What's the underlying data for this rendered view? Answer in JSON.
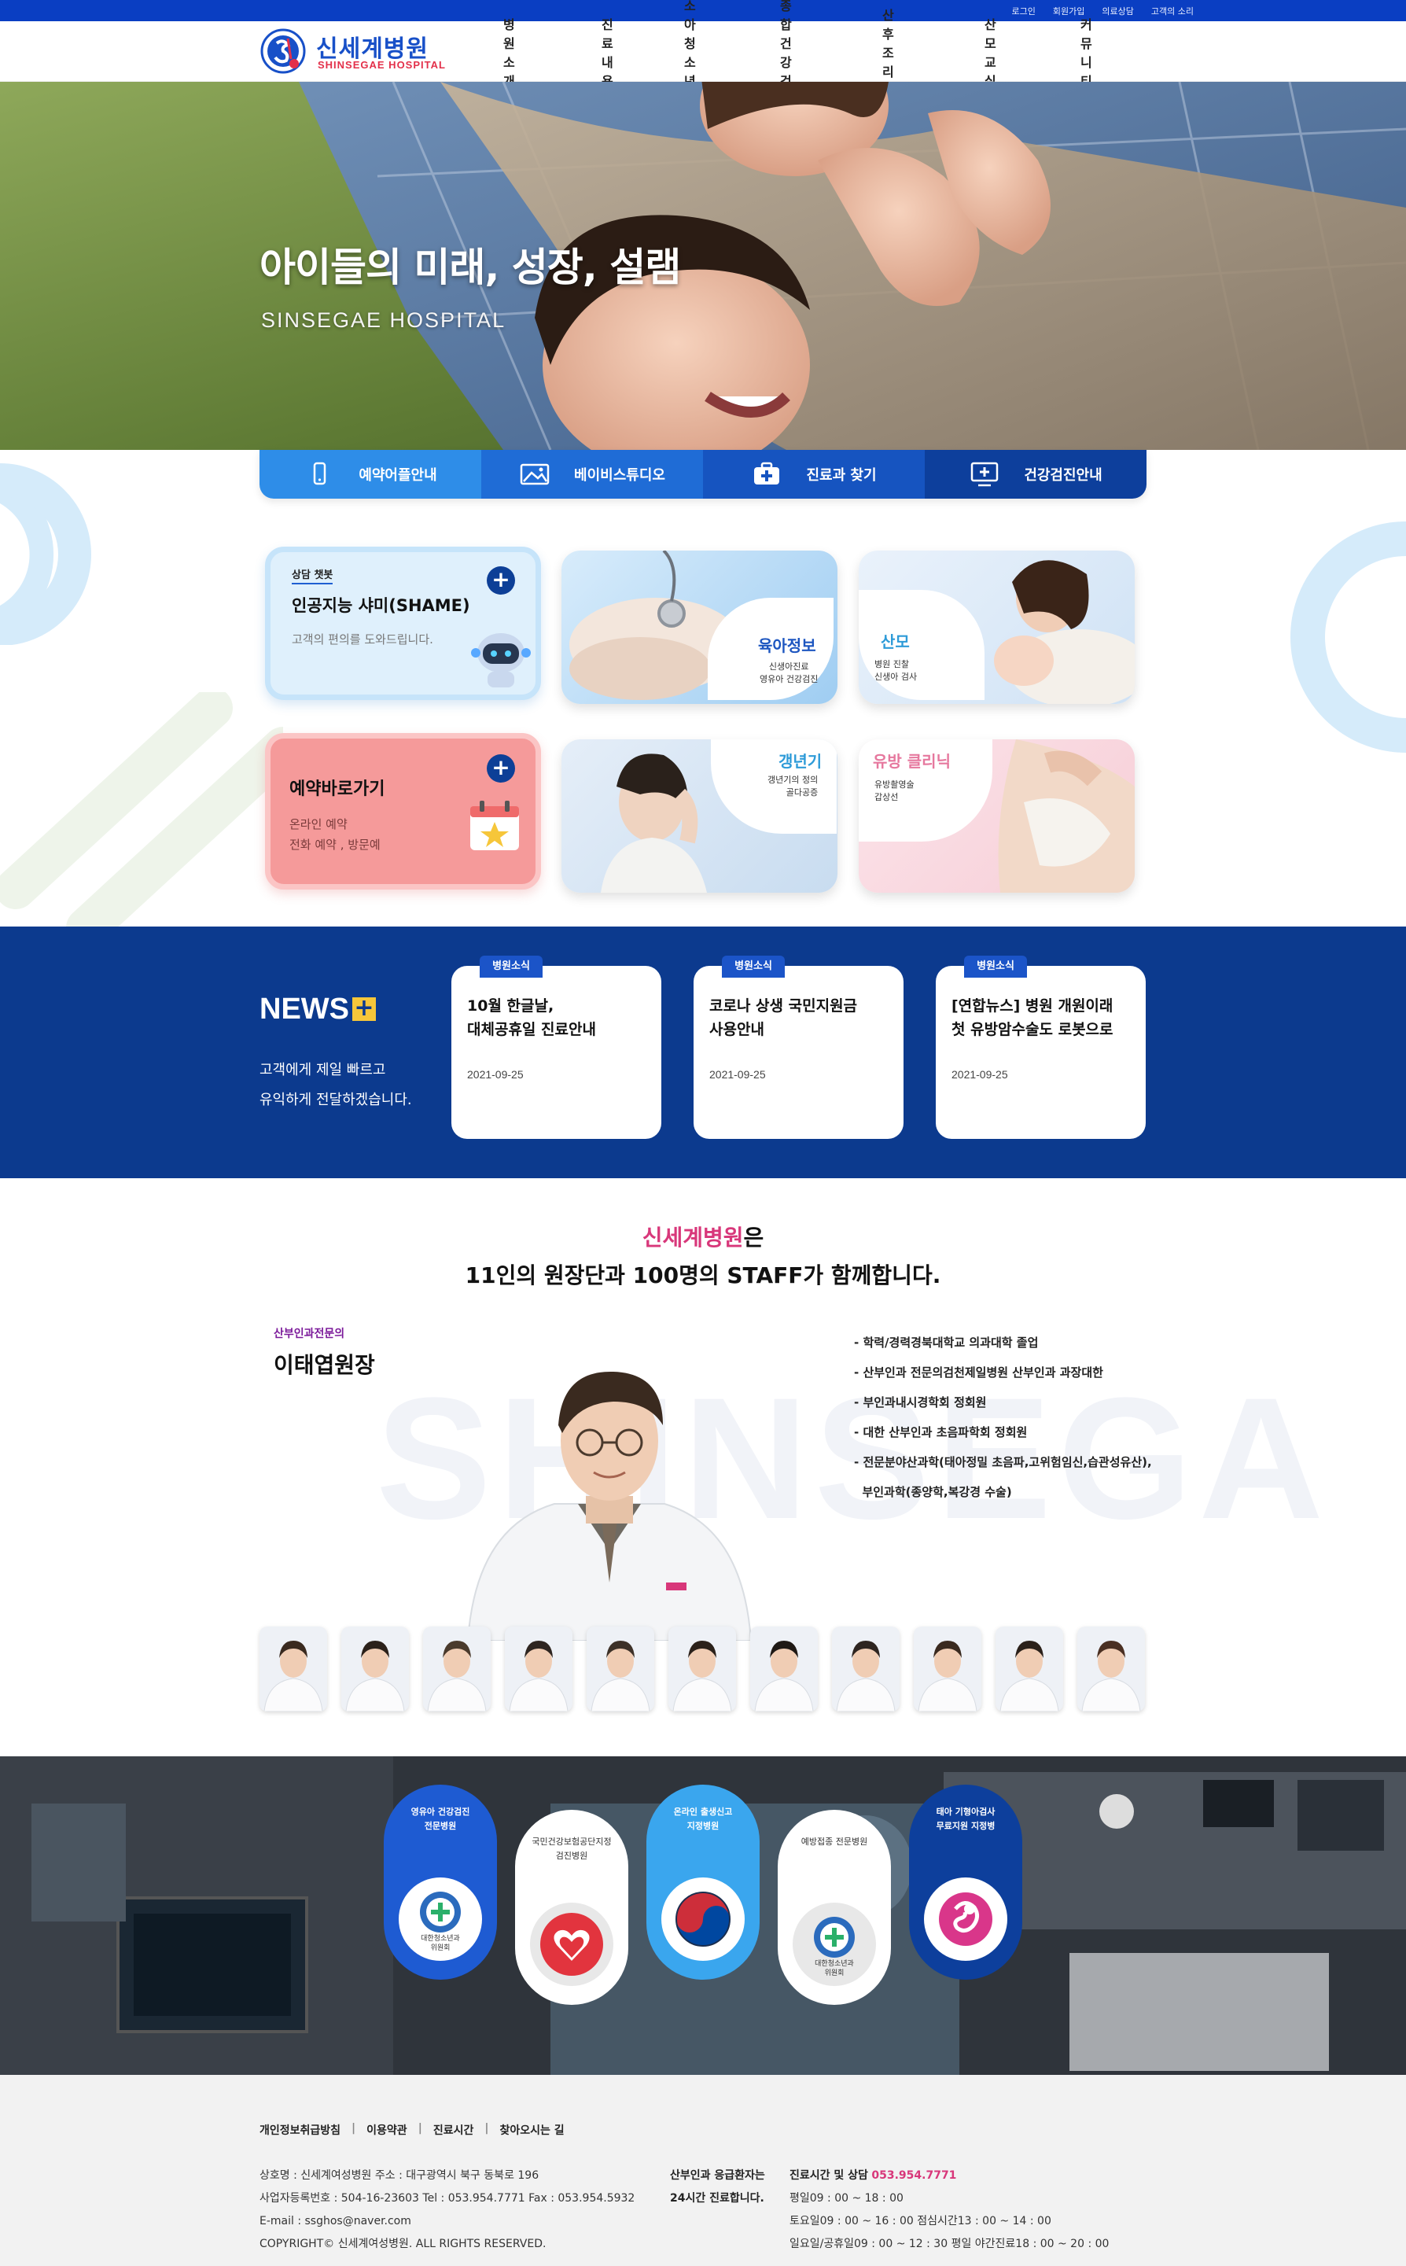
{
  "topbar": {
    "links": [
      "로그인",
      "회원가입",
      "의료상담",
      "고객의 소리"
    ]
  },
  "logo": {
    "ko": "신세계병원",
    "en": "SHINSEGAE HOSPITAL"
  },
  "nav": [
    "병원소개",
    "진료내용",
    "소아청소년과",
    "종합건강검진",
    "산후조리원",
    "산모교실",
    "커뮤니티"
  ],
  "hero": {
    "title": "아이들의 미래, 성장, 설램",
    "subtitle": "SINSEGAE HOSPITAL"
  },
  "quick": [
    {
      "label": "예약어플안내",
      "icon": "phone-icon",
      "color": "#2e8de8"
    },
    {
      "label": "베이비스튜디오",
      "icon": "photo-icon",
      "color": "#1f6cd6"
    },
    {
      "label": "진료과 찾기",
      "icon": "first-aid-icon",
      "color": "#1654c0"
    },
    {
      "label": "건강검진안내",
      "icon": "monitor-plus-icon",
      "color": "#0d3f9c"
    }
  ],
  "cards": {
    "ai": {
      "tag": "상담 챗봇",
      "title": "인공지능 샤미(SHAME)",
      "desc": "고객의 편의를 도와드립니다."
    },
    "reserve": {
      "title": "예약바로가기",
      "line1": "온라인 예약",
      "line2": "전화 예약 , 방문예"
    },
    "parenting": {
      "title": "육아정보",
      "line1": "신생아진료",
      "line2": "영유아 건강검진"
    },
    "mother": {
      "title": "산모",
      "line1": "병원 진찰",
      "line2": "신생아 검사"
    },
    "menopause": {
      "title": "갱년기",
      "line1": "갱년기의 정의",
      "line2": "골다공증"
    },
    "breast": {
      "title": "유방 클리닉",
      "line1": "유방촬영술",
      "line2": "갑상선"
    }
  },
  "news": {
    "title": "NEWS",
    "desc1": "고객에게 제일 빠르고",
    "desc2": "유익하게 전달하겠습니다.",
    "items": [
      {
        "tag": "병원소식",
        "line1": "10월 한글날,",
        "line2": "대체공휴일 진료안내",
        "date": "2021-09-25"
      },
      {
        "tag": "병원소식",
        "line1": "코로나 상생 국민지원금",
        "line2": "사용안내",
        "date": "2021-09-25"
      },
      {
        "tag": "병원소식",
        "line1": "[연합뉴스] 병원 개원이래",
        "line2": "첫 유방암수술도 로봇으로",
        "date": "2021-09-25"
      }
    ]
  },
  "staff": {
    "brand": "신세계병원",
    "brand_suffix": "은",
    "line2": "11인의 원장단과 100명의 STAFF가 함께합니다.",
    "watermark": "SHINSEGA",
    "specialty": "산부인과전문의",
    "name": "이태엽원장",
    "career": [
      "- 학력/경력경북대학교 의과대학 졸업",
      "- 산부인과 전문의검천제일병원 산부인과 과장대한",
      "- 부인과내시경학회 정회원",
      "- 대한 산부인과 초음파학회 정회원",
      "- 전문분야산과학(태아정밀 초음파,고위험임신,습관성유산),",
      "  부인과학(종양학,복강경 수술)"
    ]
  },
  "certs": [
    {
      "text1": "영유아 건강검진",
      "text2": "전문병원",
      "inner1": "대한청소년과",
      "inner2": "위원회"
    },
    {
      "text1": "국민건강보험공단지정",
      "text2": "검진병원",
      "inner1": "",
      "inner2": ""
    },
    {
      "text1": "온라인 출생신고",
      "text2": "지정병원",
      "inner1": "",
      "inner2": ""
    },
    {
      "text1": "예방접종 전문병원",
      "text2": "",
      "inner1": "대한청소년과",
      "inner2": "위원회"
    },
    {
      "text1": "태아 기형아검사",
      "text2": "무료지원 지정병",
      "inner1": "",
      "inner2": ""
    }
  ],
  "footer": {
    "links": [
      "개인정보취급방침",
      "이용약관",
      "진료시간",
      "찾아오시는 길"
    ],
    "info": [
      "상호명 : 신세계여성병원 주소 : 대구광역시 북구 동북로 196",
      "사업자등록번호 : 504-16-23603 Tel : 053.954.7771 Fax : 053.954.5932",
      "E-mail : ssghos@naver.com",
      "COPYRIGHT© 신세계여성병원. ALL RIGHTS RESERVED."
    ],
    "emergency1": "산부인과 응급환자는",
    "emergency2": "24시간 진료합니다.",
    "hours_title": "진료시간 및 상담",
    "hours_tel": "053.954.7771",
    "hours": [
      "평일09 : 00 ~ 18 : 00",
      "토요일09 : 00 ~ 16 : 00 점심시간13 : 00 ~ 14 : 00",
      "일요일/공휴일09 : 00 ~ 12 : 30 평일 야간진료18 : 00 ~ 20 : 00"
    ]
  }
}
